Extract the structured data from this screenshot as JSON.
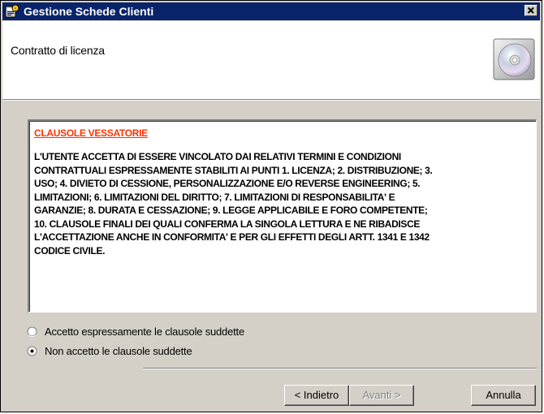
{
  "window": {
    "title": "Gestione Schede Clienti",
    "close_label": "×"
  },
  "header": {
    "title": "Contratto di licenza",
    "icon": "cd-disc-icon"
  },
  "license": {
    "heading": "CLAUSOLE VESSATORIE",
    "lines": [
      "L'UTENTE ACCETTA DI ESSERE VINCOLATO DAI RELATIVI TERMINI E CONDIZIONI",
      "CONTRATTUALI ESPRESSAMENTE STABILITI AI PUNTI 1. LICENZA; 2. DISTRIBUZIONE; 3.",
      "USO; 4. DIVIETO DI CESSIONE, PERSONALIZZAZIONE E/O REVERSE ENGINEERING; 5.",
      "LIMITAZIONI; 6. LIMITAZIONI DEL DIRITTO; 7. LIMITAZIONI DI RESPONSABILITA' E",
      "GARANZIE; 8. DURATA E CESSAZIONE; 9. LEGGE APPLICABILE E FORO COMPETENTE;",
      "10. CLAUSOLE FINALI DEI QUALI CONFERMA LA SINGOLA LETTURA E NE RIBADISCE",
      "L'ACCETTAZIONE ANCHE IN CONFORMITA' E PER GLI EFFETTI DEGLI ARTT. 1341 E 1342",
      "CODICE CIVILE."
    ],
    "heading_color": "#ff3300"
  },
  "options": {
    "accept_label": "Accetto espressamente le clausole suddette",
    "reject_label": "Non accetto le clausole suddette",
    "selected": "reject"
  },
  "buttons": {
    "back_label": "< Indietro",
    "next_label": "Avanti >",
    "cancel_label": "Annulla"
  },
  "colors": {
    "titlebar": "#0a246a",
    "face": "#d4d0c8"
  }
}
